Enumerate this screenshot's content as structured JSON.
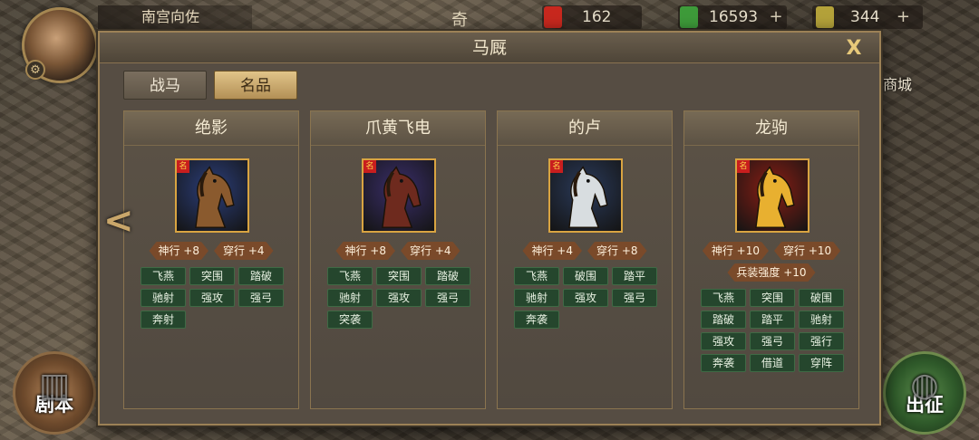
{
  "top_bar": {
    "player_name": "南宫向佐",
    "title_char": "奇",
    "resources": [
      {
        "name": "red-token",
        "value": "162",
        "color": "#c8281e"
      },
      {
        "name": "jade",
        "value": "16593",
        "color": "#3e9b3a"
      },
      {
        "name": "gold-ingot",
        "value": "344",
        "color": "#b4a23a"
      }
    ],
    "plus": "+"
  },
  "side": {
    "shop_label": "商城",
    "script_btn": "剧本",
    "battle_btn": "出征",
    "prev_arrow": "<"
  },
  "dialog": {
    "title": "马厩",
    "close": "X",
    "tabs": [
      {
        "label": "战马",
        "active": false
      },
      {
        "label": "名品",
        "active": true
      }
    ],
    "horses": [
      {
        "name": "绝影",
        "rank": "名",
        "coat": "#8a5a2e",
        "bg": "#2b3e7a",
        "stats": [
          "神行 +8",
          "穿行 +4"
        ],
        "extra": "",
        "skills": [
          "飞燕",
          "突围",
          "踏破",
          "驰射",
          "强攻",
          "强弓",
          "奔射"
        ]
      },
      {
        "name": "爪黄飞电",
        "rank": "名",
        "coat": "#6e2a1e",
        "bg": "#3a2e6a",
        "stats": [
          "神行 +8",
          "穿行 +4"
        ],
        "extra": "",
        "skills": [
          "飞燕",
          "突围",
          "踏破",
          "驰射",
          "强攻",
          "强弓",
          "突袭"
        ]
      },
      {
        "name": "的卢",
        "rank": "名",
        "coat": "#d8dde0",
        "bg": "#2a3a5a",
        "stats": [
          "神行 +4",
          "穿行 +8"
        ],
        "extra": "",
        "skills": [
          "飞燕",
          "破围",
          "踏平",
          "驰射",
          "强攻",
          "强弓",
          "奔袭"
        ]
      },
      {
        "name": "龙驹",
        "rank": "名",
        "coat": "#e8b030",
        "bg": "#8a1e14",
        "stats": [
          "神行 +10",
          "穿行 +10"
        ],
        "extra": "兵装强度 +10",
        "skills": [
          "飞燕",
          "突围",
          "破围",
          "踏破",
          "踏平",
          "驰射",
          "强攻",
          "强弓",
          "强行",
          "奔袭",
          "借道",
          "穿阵"
        ]
      }
    ]
  }
}
